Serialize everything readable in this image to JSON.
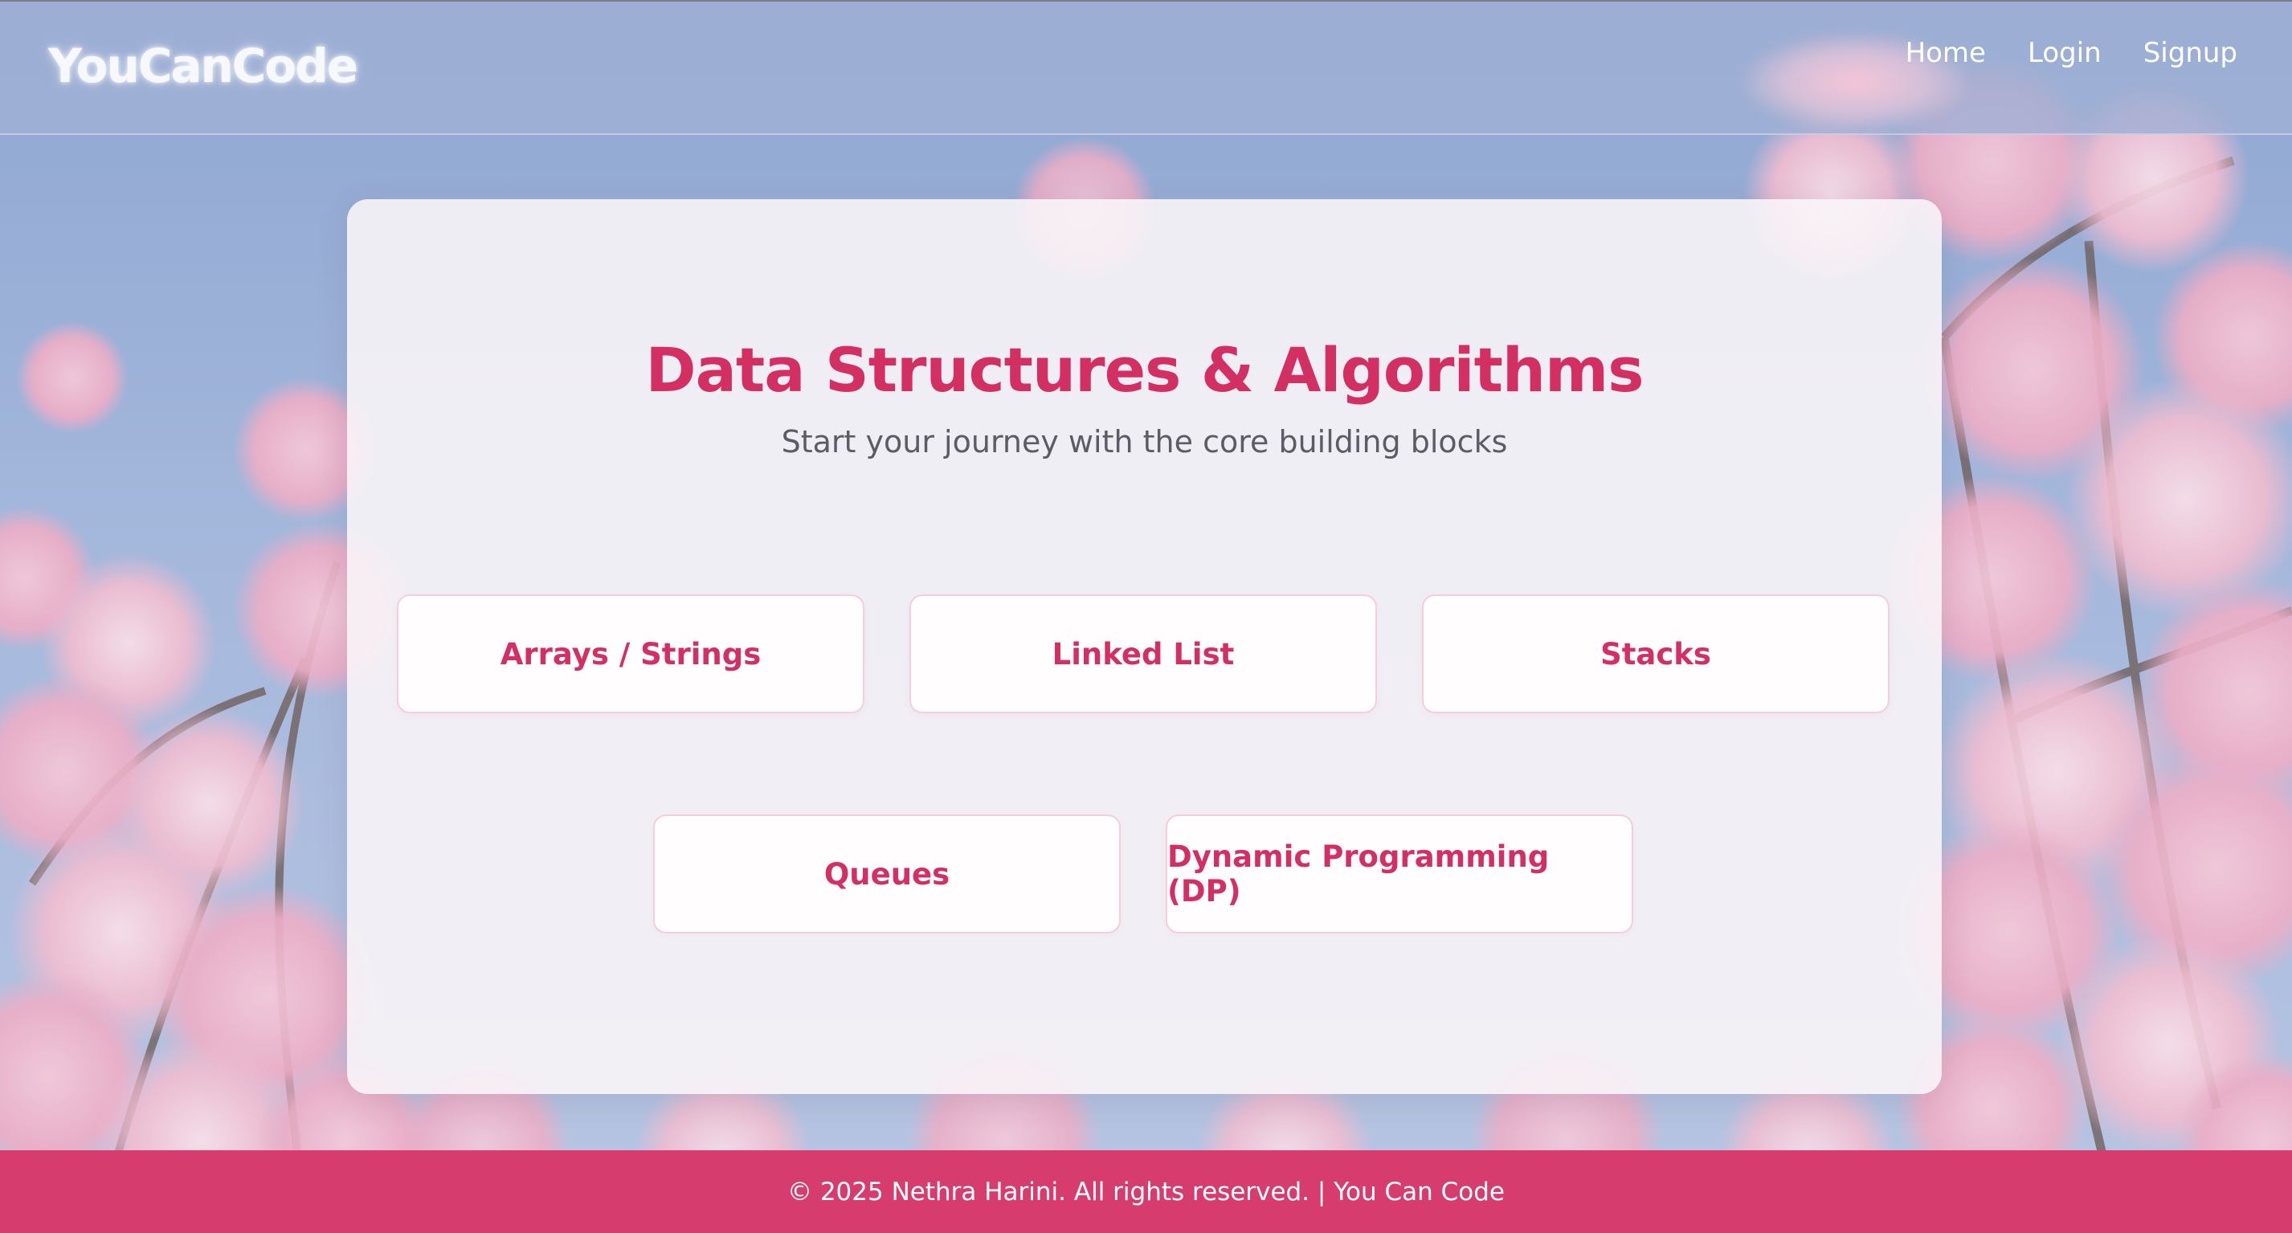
{
  "navbar": {
    "brand": "YouCanCode",
    "links": [
      "Home",
      "Login",
      "Signup"
    ]
  },
  "main": {
    "title": "Data Structures & Algorithms",
    "subtitle": "Start your journey with the core building blocks",
    "topics": [
      "Arrays / Strings",
      "Linked List",
      "Stacks",
      "Queues",
      "Dynamic Programming (DP)"
    ]
  },
  "footer": {
    "text": "© 2025 Nethra Harini. All rights reserved. | You Can Code"
  },
  "colors": {
    "accent": "#d32f62",
    "footer_bg": "#d63c6d",
    "sky": "#a4b6d7"
  }
}
